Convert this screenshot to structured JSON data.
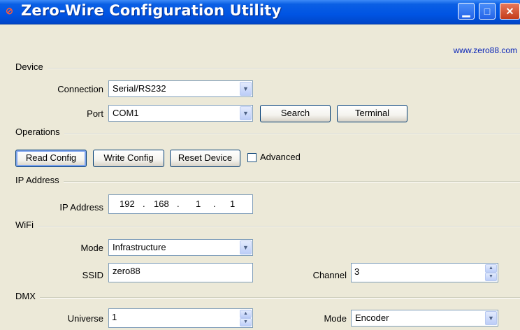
{
  "window": {
    "title": "Zero-Wire Configuration Utility",
    "minimize_glyph": "▁",
    "maximize_glyph": "□",
    "close_glyph": "✕"
  },
  "url": "www.zero88.com",
  "device": {
    "group_label": "Device",
    "connection_label": "Connection",
    "connection_value": "Serial/RS232",
    "port_label": "Port",
    "port_value": "COM1",
    "search_label": "Search",
    "terminal_label": "Terminal"
  },
  "operations": {
    "group_label": "Operations",
    "read_label": "Read Config",
    "write_label": "Write Config",
    "reset_label": "Reset Device",
    "advanced_label": "Advanced",
    "advanced_checked": false
  },
  "ip": {
    "group_label": "IP Address",
    "ip_label": "IP Address",
    "octets": [
      "192",
      "168",
      "1",
      "1"
    ],
    "dot": "."
  },
  "wifi": {
    "group_label": "WiFi",
    "mode_label": "Mode",
    "mode_value": "Infrastructure",
    "ssid_label": "SSID",
    "ssid_value": "zero88",
    "channel_label": "Channel",
    "channel_value": "3"
  },
  "dmx": {
    "group_label": "DMX",
    "universe_label": "Universe",
    "universe_value": "1",
    "mode_label": "Mode",
    "mode_value": "Encoder"
  },
  "icons": {
    "combo_arrow": "▼",
    "spin_up": "▲",
    "spin_down": "▼",
    "app_icon": "⊘"
  },
  "colors": {
    "titlebar": "#0054e3",
    "window_bg": "#ece9d8",
    "link": "#0a25b7"
  }
}
